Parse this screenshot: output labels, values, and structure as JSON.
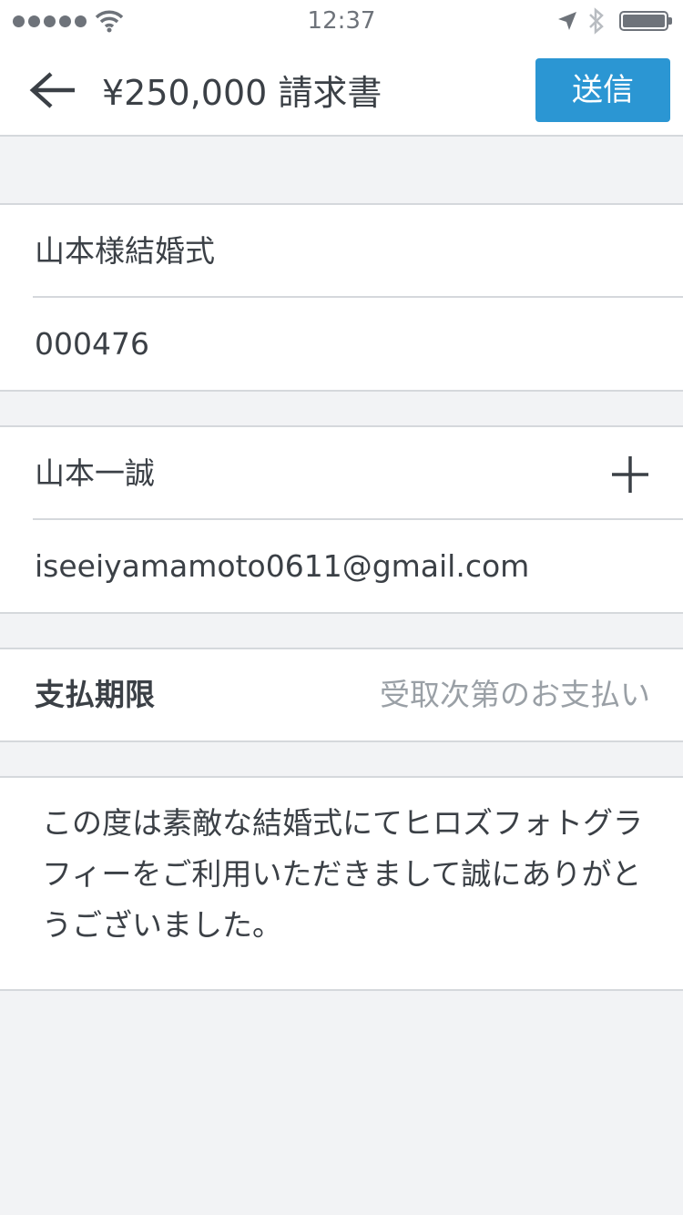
{
  "status_bar": {
    "time": "12:37",
    "icons": [
      "signal-dots",
      "wifi-icon",
      "location-icon",
      "bluetooth-icon",
      "battery-icon"
    ]
  },
  "nav": {
    "title": "¥250,000 請求書",
    "send_label": "送信",
    "accent_color": "#2b96d3"
  },
  "invoice": {
    "title": "山本様結婚式",
    "number": "000476"
  },
  "customer": {
    "name": "山本一誠",
    "email": "iseeiyamamoto0611@gmail.com"
  },
  "due": {
    "label": "支払期限",
    "value": "受取次第のお支払い"
  },
  "message": "この度は素敵な結婚式にてヒロズフォトグラフィーをご利用いただきまして誠にありがとうございました。"
}
